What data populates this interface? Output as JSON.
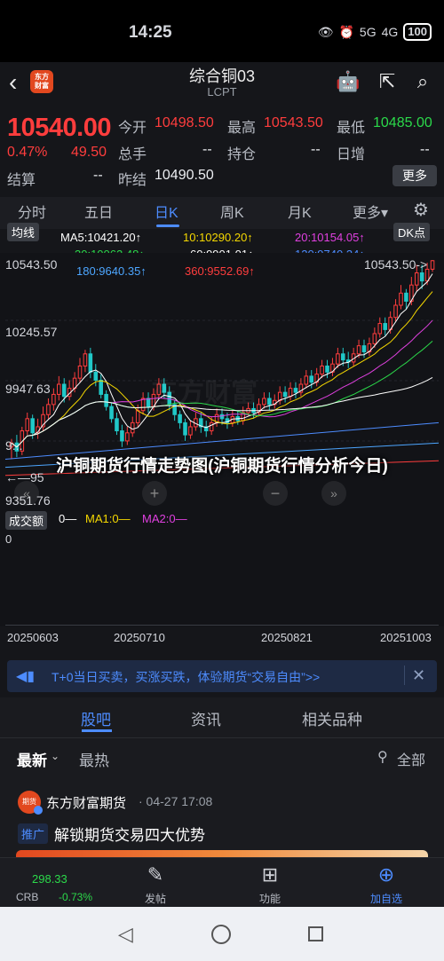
{
  "status": {
    "time": "14:25",
    "signal_a": "5G",
    "signal_b": "4G",
    "battery": "100"
  },
  "header": {
    "app_logo_text": "东方\n财富",
    "title": "综合铜03",
    "subtitle": "LCPT"
  },
  "quote": {
    "price": "10540.00",
    "change_pct": "0.47%",
    "change_abs": "49.50",
    "open_label": "今开",
    "open": "10498.50",
    "high_label": "最高",
    "high": "10543.50",
    "low_label": "最低",
    "low": "10485.00",
    "volume_label": "总手",
    "volume": "--",
    "oi_label": "持仓",
    "oi": "--",
    "daily_inc_label": "日增",
    "daily_inc": "--",
    "settle_label": "结算",
    "settle": "--",
    "prev_label": "昨结",
    "prev": "10490.50",
    "more": "更多"
  },
  "period_tabs": [
    "分时",
    "五日",
    "日K",
    "周K",
    "月K",
    "更多▾"
  ],
  "active_period": "日K",
  "indicators": {
    "avg_button": "均线",
    "dk_button": "DK点",
    "ma5": "MA5:10421.20↑",
    "ma10": "10:10290.20↑",
    "ma20": "20:10154.05↑",
    "ma30": "30:10062.48↑",
    "ma60": "60:9901.01↑",
    "ma120": "120:9740.34↑",
    "ma180": "180:9640.35↑",
    "ma360": "360:9552.69↑"
  },
  "colors": {
    "up": "#ff3d3d",
    "down": "#21c8c8",
    "ma5": "#ffffff",
    "ma10": "#f5d800",
    "ma20": "#e040e0",
    "ma30": "#2bd94a",
    "ma60": "#ffffff",
    "ma120": "#4d8cff",
    "ma180": "#4da6ff",
    "ma360": "#ff3d3d",
    "accent": "#4d8cff"
  },
  "chart": {
    "y_top": "10543.50",
    "y_2": "10245.57",
    "y_3": "9947.63",
    "y_4": "9...",
    "y_bottom": "9351.76",
    "low_marker": "←—95",
    "high_marker": "10543.50->",
    "cn_watermark": "东方财富"
  },
  "volume": {
    "label": "成交额",
    "v0": "0—",
    "ma1": "MA1:0—",
    "ma2": "MA2:0—",
    "zero": "0"
  },
  "dates": [
    "20250603",
    "20250710",
    "20250821",
    "20251003"
  ],
  "overlay_title": "沪铜期货行情走势图(沪铜期货行情分析今日)",
  "banner": {
    "text": "T+0当日买卖，买涨买跌，体验期货“交易自由”>>"
  },
  "content_tabs": [
    "股吧",
    "资讯",
    "相关品种"
  ],
  "feed_filters": {
    "latest": "最新",
    "hot": "最热",
    "all": "全部"
  },
  "post": {
    "author": "东方财富期货",
    "time": "· 04-27 17:08",
    "tag": "推广",
    "title": "解锁期货交易四大优势"
  },
  "bottom_nav": {
    "crb_value": "298.33",
    "crb_label": "CRB",
    "crb_change": "-0.73%",
    "post": "发帖",
    "func": "功能",
    "add": "加自选"
  },
  "chart_data": {
    "type": "candlestick",
    "ylim": [
      9351.76,
      10543.5
    ],
    "x_ticks": [
      "20250603",
      "20250710",
      "20250821",
      "20251003"
    ],
    "candles": [
      [
        9620,
        9640,
        9560,
        9660
      ],
      [
        9640,
        9600,
        9570,
        9680
      ],
      [
        9600,
        9700,
        9580,
        9720
      ],
      [
        9700,
        9760,
        9680,
        9790
      ],
      [
        9760,
        9690,
        9660,
        9780
      ],
      [
        9690,
        9720,
        9660,
        9760
      ],
      [
        9720,
        9780,
        9700,
        9820
      ],
      [
        9780,
        9830,
        9760,
        9860
      ],
      [
        9830,
        9880,
        9800,
        9910
      ],
      [
        9880,
        9930,
        9850,
        9970
      ],
      [
        9930,
        9870,
        9840,
        9960
      ],
      [
        9870,
        9910,
        9850,
        9950
      ],
      [
        9910,
        9960,
        9890,
        9990
      ],
      [
        9960,
        10020,
        9940,
        10060
      ],
      [
        10020,
        10080,
        9990,
        10100
      ],
      [
        10080,
        9990,
        9960,
        10110
      ],
      [
        9990,
        9950,
        9920,
        10030
      ],
      [
        9950,
        9880,
        9860,
        9980
      ],
      [
        9880,
        9820,
        9800,
        9900
      ],
      [
        9820,
        9760,
        9740,
        9840
      ],
      [
        9760,
        9700,
        9680,
        9790
      ],
      [
        9700,
        9650,
        9620,
        9730
      ],
      [
        9650,
        9690,
        9630,
        9720
      ],
      [
        9690,
        9740,
        9670,
        9770
      ],
      [
        9740,
        9800,
        9720,
        9830
      ],
      [
        9800,
        9860,
        9780,
        9890
      ],
      [
        9860,
        9820,
        9790,
        9890
      ],
      [
        9820,
        9880,
        9800,
        9910
      ],
      [
        9880,
        9930,
        9860,
        9960
      ],
      [
        9930,
        9890,
        9860,
        9960
      ],
      [
        9890,
        9830,
        9800,
        9920
      ],
      [
        9830,
        9780,
        9750,
        9850
      ],
      [
        9780,
        9740,
        9710,
        9800
      ],
      [
        9740,
        9680,
        9650,
        9760
      ],
      [
        9680,
        9720,
        9660,
        9750
      ],
      [
        9720,
        9760,
        9700,
        9790
      ],
      [
        9760,
        9720,
        9690,
        9790
      ],
      [
        9720,
        9700,
        9670,
        9750
      ],
      [
        9700,
        9740,
        9680,
        9770
      ],
      [
        9740,
        9780,
        9720,
        9810
      ],
      [
        9780,
        9760,
        9730,
        9810
      ],
      [
        9760,
        9740,
        9710,
        9790
      ],
      [
        9740,
        9770,
        9720,
        9800
      ],
      [
        9770,
        9750,
        9730,
        9800
      ],
      [
        9750,
        9790,
        9730,
        9820
      ],
      [
        9790,
        9810,
        9770,
        9840
      ],
      [
        9810,
        9790,
        9760,
        9840
      ],
      [
        9790,
        9830,
        9770,
        9860
      ],
      [
        9830,
        9860,
        9810,
        9890
      ],
      [
        9860,
        9830,
        9800,
        9890
      ],
      [
        9830,
        9850,
        9810,
        9880
      ],
      [
        9850,
        9890,
        9830,
        9920
      ],
      [
        9890,
        9870,
        9840,
        9920
      ],
      [
        9870,
        9910,
        9850,
        9940
      ],
      [
        9910,
        9890,
        9860,
        9940
      ],
      [
        9890,
        9930,
        9870,
        9960
      ],
      [
        9930,
        9970,
        9910,
        10000
      ],
      [
        9970,
        9940,
        9910,
        10000
      ],
      [
        9940,
        9980,
        9920,
        10010
      ],
      [
        9980,
        10020,
        9960,
        10050
      ],
      [
        10020,
        9990,
        9960,
        10050
      ],
      [
        9990,
        10030,
        9970,
        10060
      ],
      [
        10030,
        10080,
        10010,
        10110
      ],
      [
        10080,
        10050,
        10020,
        10110
      ],
      [
        10050,
        10040,
        10010,
        10090
      ],
      [
        10040,
        10080,
        10020,
        10110
      ],
      [
        10080,
        10120,
        10060,
        10150
      ],
      [
        10120,
        10090,
        10060,
        10150
      ],
      [
        10090,
        10130,
        10070,
        10160
      ],
      [
        10130,
        10180,
        10110,
        10210
      ],
      [
        10180,
        10230,
        10160,
        10260
      ],
      [
        10230,
        10200,
        10170,
        10260
      ],
      [
        10200,
        10260,
        10180,
        10290
      ],
      [
        10260,
        10320,
        10240,
        10350
      ],
      [
        10320,
        10380,
        10300,
        10420
      ],
      [
        10380,
        10340,
        10300,
        10400
      ],
      [
        10340,
        10420,
        10320,
        10460
      ],
      [
        10420,
        10480,
        10390,
        10520
      ],
      [
        10480,
        10440,
        10400,
        10520
      ],
      [
        10440,
        10498,
        10420,
        10530
      ],
      [
        10498,
        10540,
        10485,
        10543.5
      ]
    ]
  }
}
